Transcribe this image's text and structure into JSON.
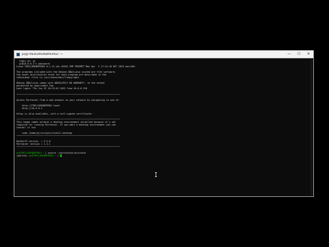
{
  "window": {
    "title": "pi@TREILORENDPER02: ~",
    "minimize": "—",
    "maximize": "☐",
    "close": "✕"
  },
  "terminal": {
    "lines": [
      "  login as: pi",
      "  pi@10.0.0.2's password:",
      "Linux TREILORENDPER02 6.1.21-v8+ #1642 SMP PREEMPT Mon Apr  3 17:24:16 BST 2023 aarch64",
      "",
      "The programs included with the Debian GNU/Linux system are free software;",
      "the exact distribution terms for each program are described in the",
      "individual files in /usr/share/doc/*/copyright.",
      "",
      "Debian GNU/Linux comes with ABSOLUTELY NO WARRANTY, to the extent",
      "permitted by applicable law.",
      "Last login: Thu Jun 22 10:23:45 2023 from 10.0.0.220",
      "",
      "────────────────────────────────────────────────────────────────────────────",
      "",
      "Access Portainer from a web browser on your network by navigating to one of:",
      "",
      "    http://TREILORENDPER02.local",
      "    http://10.0.0.2",
      "",
      "https is also available, with a self-signed certificate:",
      "",
      "────────────────────────────────────────────────────────────────────────────",
      "This image comes without a desktop environment installed because it's not",
      "required for running Portainer. If you want a desktop environment you can",
      "install it via",
      "",
      "    sudo /home/pi/scripts/install-desktop",
      "────────────────────────────────────────────────────────────────────────────",
      "",
      "DockerCE version  = 5.3.6",
      "Portainer version = 1.3.1",
      "────────────────────────────────────────────────────────────────────────────",
      ""
    ],
    "prompt1_user": "pi@TREILORENDPER02:~ $ ",
    "prompt1_cmd": "source ~/portsh/bin/activate",
    "prompt2_env": "(portsh) ",
    "prompt2_user": "pi@TREILORENDPER02:~ $ "
  },
  "colors": {
    "terminal_bg": "#0c0c0c",
    "terminal_fg": "#cfcfcf",
    "prompt_green": "#16c60c"
  }
}
